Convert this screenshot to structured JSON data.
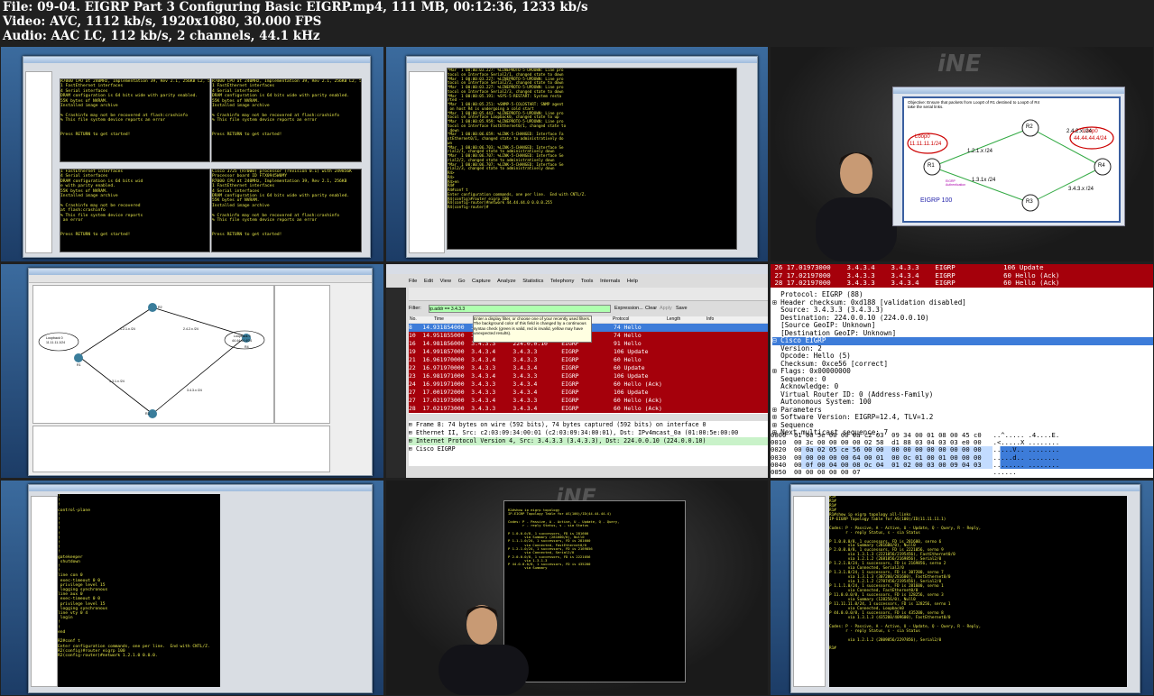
{
  "header": {
    "line1": "File: 09-04. EIGRP Part 3 Configuring Basic EIGRP.mp4, 111 MB, 00:12:36, 1233 kb/s",
    "line2": "Video: AVC, 1112 kb/s, 1920x1080, 30.000 FPS",
    "line3": "Audio: AAC LC, 112 kb/s, 2 channels, 44.1 kHz"
  },
  "thumb1": {
    "term_a": "R7000 CPU at 240MHz, Implementation 39, Rev 2.1, 256KB L2, 512KB L3 Cache\n1 FastEthernet interfaces\n4 Serial interfaces\nDRAM configuration is 64 bits wide with parity enabled.\n55K bytes of NVRAM.\nInstalled image archive\n\n% Crashinfo may not be recovered at flash:crashinfo\n% This file system device reports an error\n\n\nPress RETURN to get started!",
    "term_b": "R7000 CPU at 240MHz, Implementation 39, Rev 2.1, 256KB L2, 512KB L3 Cache\n1 FastEthernet interfaces\n4 Serial interfaces\nDRAM configuration is 64 bits wide with parity enabled.\n55K bytes of NVRAM.\nInstalled image archive\n\n% Crashinfo may not be recovered at flash:crashinfo\n% This file system device reports an error\n\n\nPress RETURN to get started!",
    "term_c": "1 FastEthernet interfaces\n4 Serial interfaces\nDRAM configuration is 64 bits wid\ne with parity enabled.\n55K bytes of NVRAM.\nInstalled image archive\n\n% Crashinfo may not be recovered\nat flash:crashinfo\n% This file system device reports\n an error\n\n\nPress RETURN to get started!",
    "term_d": "Cisco 3725 (R7000) processor (revision 0.1) with 249856K\nProcessor board ID FTX0945W0MY\nR7000 CPU at 240MHz, Implementation 39, Rev 2.1, 256KB\n1 FastEthernet interfaces\n4 Serial interfaces\nDRAM configuration is 64 bits wide with parity enabled.\n55K bytes of NVRAM.\nInstalled image archive\n\n% Crashinfo may not be recovered at flash:crashinfo\n% This file system device reports an error\n\n\nPress RETURN to get started!"
  },
  "thumb2": {
    "term": "*Mar  1 00:00:03.227: %LINEPROTO-5-UPDOWN: Line pro\ntocol on Interface Serial2/1, changed state to down\n*Mar  1 00:00:03.227: %LINEPROTO-5-UPDOWN: Line pro\ntocol on Interface Serial2/2, changed state to down\n*Mar  1 00:00:03.227: %LINEPROTO-5-UPDOWN: Line pro\ntocol on Interface Serial2/3, changed state to down\n*Mar  1 00:00:05.191: %SYS-5-RESTART: System resta\nrted --\n*Mar  1 00:00:05.251: %SNMP-5-COLDSTART: SNMP agent\n on host R4 is undergoing a cold start\n*Mar  1 00:00:05.443: %LINEPROTO-5-UPDOWN: Line pro\ntocol on Interface Loopback0, changed state to up\n*Mar  1 00:00:05.959: %LINEPROTO-5-UPDOWN: Line pro\ntocol on Interface FastEthernet0/1, changed state to\n down\n*Mar  1 00:00:06.659: %LINK-5-CHANGED: Interface Fa\nstEthernet0/1, changed state to administratively do\nwn\n*Mar  1 00:00:06.703: %LINK-5-CHANGED: Interface Se\nrial2/1, changed state to administratively down\n*Mar  1 00:00:06.707: %LINK-5-CHANGED: Interface Se\nrial2/2, changed state to administratively down\n*Mar  1 00:00:06.707: %LINK-5-CHANGED: Interface Se\nrial2/3, changed state to administratively down\nR4>\nR4>\nR4>en\nR4#\nR4#conf t\nEnter configuration commands, one per line.  End with CNTL/Z.\nR4(config)#router eigrp 100\nR4(config-router)#network 44.44.44.0 0.0.0.255\nR4(config-router)#"
  },
  "thumb3": {
    "objective": "Objective: Ensure that packets from Loop0 of R1 destined to Loop0 of R4 take the serial links.",
    "loop0_left": "Loop0",
    "loop0_left_addr": "11.11.11.1/24",
    "loop0_right": "Loop0",
    "loop0_right_addr": "44.44.44.4/24",
    "r1": "R1",
    "r2": "R2",
    "r3": "R3",
    "r4": "R4",
    "link12": "1.2.1.x /24",
    "link24": "2.4.2.x /24",
    "link13": "1.3.1x /24",
    "link34": "3.4.3.x /24",
    "eigrp_auth": "EIGRP Authentication",
    "eigrp_as": "EIGRP 100"
  },
  "thumb5": {
    "filter_label": "Filter:",
    "filter_value": "ip.addr == 3.4.3.3",
    "expression": "Expression...",
    "clear": "Clear",
    "apply": "Apply",
    "save": "Save",
    "col_no": "No.",
    "col_time": "Time",
    "col_protocol": "Protocol",
    "col_length": "Length",
    "col_info": "Info",
    "tooltip": "Enter a display filter, or choose one of your recently used filters. The background color of this field is changed by a continuous syntax check (green is valid, red is invalid, yellow may have unexpected results).",
    "menu": [
      "File",
      "Edit",
      "View",
      "Go",
      "Capture",
      "Analyze",
      "Statistics",
      "Telephony",
      "Tools",
      "Internals",
      "Help"
    ],
    "rows": [
      {
        "n": "8",
        "t": "14.931854000",
        "s": "3.4.3.3",
        "d": "224.0.0.10",
        "p": "EIGRP",
        "i": "74 Hello"
      },
      {
        "n": "10",
        "t": "14.951855000",
        "s": "3.4.3.3",
        "d": "224.0.0.10",
        "p": "EIGRP",
        "i": "74 Hello"
      },
      {
        "n": "16",
        "t": "14.981856000",
        "s": "3.4.3.3",
        "d": "224.0.0.10",
        "p": "EIGRP",
        "i": "91 Hello"
      },
      {
        "n": "19",
        "t": "14.991857000",
        "s": "3.4.3.4",
        "d": "3.4.3.3",
        "p": "EIGRP",
        "i": "106 Update"
      },
      {
        "n": "21",
        "t": "16.961970000",
        "s": "3.4.3.4",
        "d": "3.4.3.3",
        "p": "EIGRP",
        "i": "60 Hello"
      },
      {
        "n": "22",
        "t": "16.971970000",
        "s": "3.4.3.3",
        "d": "3.4.3.4",
        "p": "EIGRP",
        "i": "60 Update"
      },
      {
        "n": "23",
        "t": "16.981971000",
        "s": "3.4.3.4",
        "d": "3.4.3.3",
        "p": "EIGRP",
        "i": "106 Update"
      },
      {
        "n": "24",
        "t": "16.991971000",
        "s": "3.4.3.3",
        "d": "3.4.3.4",
        "p": "EIGRP",
        "i": "60 Hello (Ack)"
      },
      {
        "n": "27",
        "t": "17.001972000",
        "s": "3.4.3.3",
        "d": "3.4.3.4",
        "p": "EIGRP",
        "i": "106 Update"
      },
      {
        "n": "27",
        "t": "17.021973000",
        "s": "3.4.3.4",
        "d": "3.4.3.3",
        "p": "EIGRP",
        "i": "60 Hello (Ack)"
      },
      {
        "n": "28",
        "t": "17.021973000",
        "s": "3.4.3.3",
        "d": "3.4.3.4",
        "p": "EIGRP",
        "i": "60 Hello (Ack)"
      }
    ],
    "tree": [
      "Frame 8: 74 bytes on wire (592 bits), 74 bytes captured (592 bits) on interface 0",
      "Ethernet II, Src: c2:03:09:34:00:01 (c2:03:09:34:00:01), Dst: IPv4mcast_0a (01:00:5e:00:00",
      "Internet Protocol Version 4, Src: 3.4.3.3 (3.4.3.3), Dst: 224.0.0.10 (224.0.0.10)",
      "Cisco EIGRP"
    ]
  },
  "thumb6": {
    "top_rows": [
      {
        "n": "26",
        "t": "17.01973000",
        "s": "3.4.3.4",
        "d": "3.4.3.3",
        "p": "EIGRP",
        "i": "106 Update"
      },
      {
        "n": "27",
        "t": "17.02197000",
        "s": "3.4.3.3",
        "d": "3.4.3.4",
        "p": "EIGRP",
        "i": "60 Hello (Ack)"
      },
      {
        "n": "28",
        "t": "17.02197000",
        "s": "3.4.3.3",
        "d": "3.4.3.4",
        "p": "EIGRP",
        "i": "60 Hello (Ack)"
      }
    ],
    "lines": [
      "  Protocol: EIGRP (88)",
      "⊞ Header checksum: 0xd188 [validation disabled]",
      "  Source: 3.4.3.3 (3.4.3.3)",
      "  Destination: 224.0.0.10 (224.0.0.10)",
      "  [Source GeoIP: Unknown]",
      "  [Destination GeoIP: Unknown]"
    ],
    "selected": "⊟ Cisco EIGRP",
    "lines2": [
      "  Version: 2",
      "  Opcode: Hello (5)",
      "  Checksum: 0xce56 [correct]",
      "⊞ Flags: 0x00000000",
      "  Sequence: 0",
      "  Acknowledge: 0",
      "  Virtual Router ID: 0 (Address-Family)",
      "  Autonomous System: 100",
      "⊞ Parameters",
      "⊞ Software Version: EIGRP=12.4, TLV=1.2",
      "⊞ Sequence",
      "⊞ Next multicast sequence: 7"
    ],
    "hex": [
      {
        "o": "0000",
        "h": "01 00 5e 00 00 0a c2 03  09 34 00 01 08 00 45 c0",
        "a": "..^..... .4....E."
      },
      {
        "o": "0010",
        "h": "00 3c 00 00 00 00 02 58  d1 88 03 04 03 03 e0 00",
        "a": ".<.....X ........"
      },
      {
        "o": "0020",
        "h": "00 0a 02 05 ce 56 00 00  00 00 00 00 00 00 00 00",
        "a": ".....V.. ........"
      },
      {
        "o": "0030",
        "h": "00 00 00 00 00 64 00 01  00 0c 01 00 01 00 00 00",
        "a": ".....d.. ........"
      },
      {
        "o": "0040",
        "h": "00 0f 00 04 00 08 0c 04  01 02 00 03 00 09 04 03",
        "a": "........ ........"
      },
      {
        "o": "0050",
        "h": "00 00 00 00 00 07",
        "a": "......"
      }
    ]
  },
  "thumb7": {
    "term": "!\n!\n!\ncontrol-plane\n!\n!\n!\n!\n!\n!\n!\n!\n!\ngatekeeper\n shutdown\n!\n!\nline con 0\n exec-timeout 0 0\n privilege level 15\n logging synchronous\nline aux 0\n exec-timeout 0 0\n privilege level 15\n logging synchronous\nline vty 0 4\n login\n!\n!\nend\n\nR2#conf t\nEnter configuration commands, one per line.  End with CNTL/Z.\nR2(config)#router eigrp 100\nR2(config-router)#network 1.2.1.0 0.0.0."
  },
  "thumb9": {
    "term": "R1#\nR1#\nR1#\nR1#\nR1#show ip eigrp topology all-links\nIP-EIGRP Topology Table for AS(100)/ID(11.11.11.1)\n\nCodes: P - Passive, A - Active, U - Update, Q - Query, R - Reply,\n       r - reply Status, s - sia Status\n\nP 1.0.0.0/8, 1 successors, FD is 281600, serno 6\n        via Summary (281600/0), Null0\nP 2.0.0.0/8, 1 successors, FD is 2221056, serno 9\n        via 1.3.1.3 (2221056/2195456), FastEthernet0/0\n        via 1.2.1.2 (2681856/2169856), Serial2/0\nP 1.2.1.0/24, 1 successors, FD is 2169856, serno 2\n        via Connected, Serial2/0\nP 1.3.1.0/24, 1 successors, FD is 307200, serno 7\n        via 1.3.1.3 (307200/281600), FastEthernet0/0\n        via 1.2.1.2 (2707456/2195456), Serial2/0\nP 1.1.1.0/24, 1 successors, FD is 281600, serno 1\n        via Connected, FastEthernet0/0\nP 11.0.0.0/8, 1 successors, FD is 128256, serno 3\n        via Summary (128256/0), Null0\nP 11.11.11.0/24, 1 successors, FD is 128256, serno 1\n        via Connected, Loopback0\nP 44.0.0.0/8, 1 successors, FD is 435200, serno 8\n        via 1.3.1.3 (435200/409600), FastEthernet0/0\n\nCodes: P - Passive, A - Active, U - Update, Q - Query, R - Reply,\n       r - reply Status, s - sia Status\n\n        via 1.2.1.2 (2809856/2297856), Serial2/0\n\nR1#"
  },
  "thumb8": {
    "term": "R2#show ip eigrp topology\nIP-EIGRP Topology Table for AS(100)/ID(44.44.44.4)\n\nCodes: P - Passive, A - Active, U - Update, Q - Query,\n       r - reply Status, s - sia Status\n\nP 1.0.0.0/8, 1 successors, FD is 281600\n        via Summary (281600/0), Null0\nP 1.1.1.0/24, 1 successors, FD is 281600\n        via Connected, FastEthernet0/0\nP 1.2.1.0/24, 1 successors, FD is 2169856\n        via Connected, Serial2/0\nP 2.0.0.0/8, 1 successors, FD is 2221056\n        via 1.3.1.3\nP 44.0.0.0/8, 1 successors, FD is 435200\n        via Summary"
  },
  "thumb4": {
    "loop0_left": "Loopback 0",
    "loop0_left_addr": "11.11.11.1/24",
    "loop0_right": "Loopback 0",
    "loop0_right_addr": "44.44.44.4/24",
    "r1": "R1",
    "r2": "R2",
    "r3": "R3",
    "r4": "R4",
    "link12": "1.2.1.x /24",
    "link24": "2.4.2.x /24",
    "link13": "1.3.1.x /24",
    "link34": "3.4.3.x /24"
  }
}
